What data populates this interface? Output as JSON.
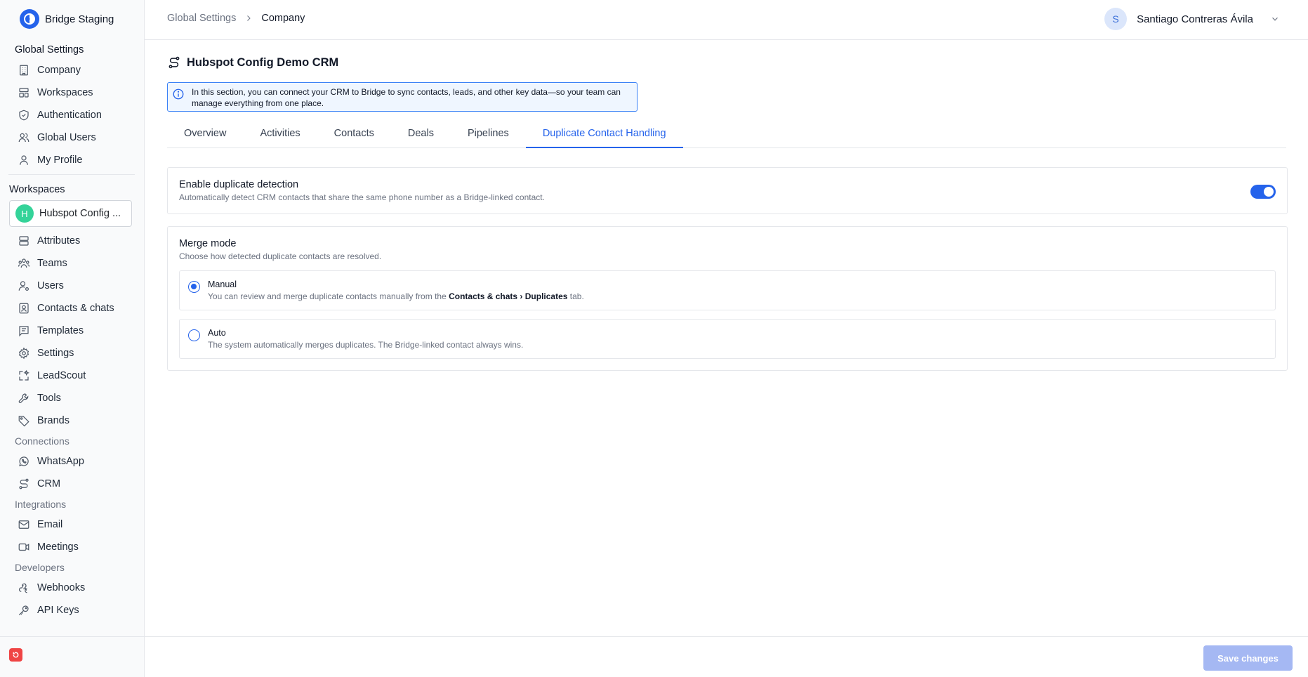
{
  "app": {
    "name": "Bridge Staging"
  },
  "sidebar": {
    "global_heading": "Global Settings",
    "global_items": [
      {
        "label": "Company",
        "icon": "building-icon"
      },
      {
        "label": "Workspaces",
        "icon": "layout-icon"
      },
      {
        "label": "Authentication",
        "icon": "shield-icon"
      },
      {
        "label": "Global Users",
        "icon": "users-icon"
      },
      {
        "label": "My Profile",
        "icon": "user-icon"
      }
    ],
    "workspaces_heading": "Workspaces",
    "workspace_selector": {
      "initial": "H",
      "name": "Hubspot Config ..."
    },
    "workspace_items": [
      {
        "label": "Attributes",
        "icon": "database-icon"
      },
      {
        "label": "Teams",
        "icon": "team-icon"
      },
      {
        "label": "Users",
        "icon": "user-gear-icon"
      },
      {
        "label": "Contacts & chats",
        "icon": "contact-icon"
      },
      {
        "label": "Templates",
        "icon": "template-icon"
      },
      {
        "label": "Settings",
        "icon": "gear-icon"
      },
      {
        "label": "LeadScout",
        "icon": "sparkle-icon"
      },
      {
        "label": "Tools",
        "icon": "wrench-icon"
      },
      {
        "label": "Brands",
        "icon": "tag-icon"
      }
    ],
    "connections_heading": "Connections",
    "connection_items": [
      {
        "label": "WhatsApp",
        "icon": "whatsapp-icon"
      },
      {
        "label": "CRM",
        "icon": "route-icon"
      }
    ],
    "integrations_heading": "Integrations",
    "integration_items": [
      {
        "label": "Email",
        "icon": "mail-icon"
      },
      {
        "label": "Meetings",
        "icon": "video-icon"
      }
    ],
    "developers_heading": "Developers",
    "developer_items": [
      {
        "label": "Webhooks",
        "icon": "webhook-icon"
      },
      {
        "label": "API Keys",
        "icon": "key-icon"
      }
    ]
  },
  "header": {
    "breadcrumb": {
      "parent": "Global Settings",
      "current": "Company"
    },
    "user": {
      "initial": "S",
      "name": "Santiago Contreras Ávila"
    }
  },
  "main": {
    "title": "Hubspot Config Demo CRM",
    "info": "In this section, you can connect your CRM to Bridge to sync contacts, leads, and other key data—so your team can manage everything from one place.",
    "tabs": [
      {
        "label": "Overview",
        "active": false
      },
      {
        "label": "Activities",
        "active": false
      },
      {
        "label": "Contacts",
        "active": false
      },
      {
        "label": "Deals",
        "active": false
      },
      {
        "label": "Pipelines",
        "active": false
      },
      {
        "label": "Duplicate Contact Handling",
        "active": true
      }
    ],
    "detection": {
      "title": "Enable duplicate detection",
      "description": "Automatically detect CRM contacts that share the same phone number as a Bridge-linked contact.",
      "enabled": true
    },
    "merge": {
      "title": "Merge mode",
      "description": "Choose how detected duplicate contacts are resolved.",
      "manual": {
        "title": "Manual",
        "desc_before": "You can review and merge duplicate contacts manually from the ",
        "desc_bold": "Contacts & chats › Duplicates",
        "desc_after": " tab.",
        "selected": true
      },
      "auto": {
        "title": "Auto",
        "description": "The system automatically merges duplicates. The Bridge-linked contact always wins.",
        "selected": false
      }
    }
  },
  "footer": {
    "save_label": "Save changes"
  },
  "colors": {
    "accent": "#2563eb",
    "save_disabled": "#a5b8f3",
    "workspace_avatar": "#34d399"
  }
}
